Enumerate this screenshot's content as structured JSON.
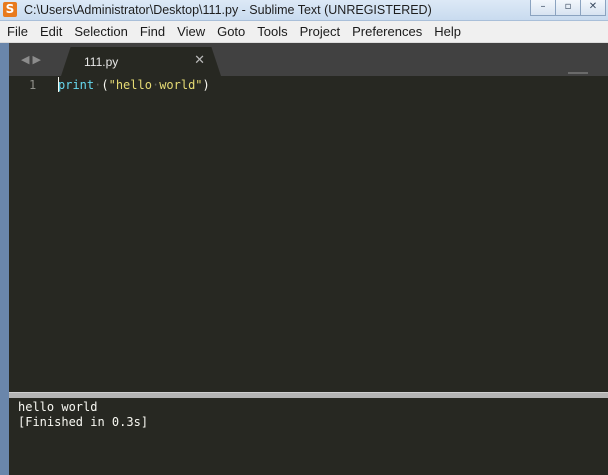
{
  "window": {
    "title": "C:\\Users\\Administrator\\Desktop\\111.py - Sublime Text (UNREGISTERED)",
    "icon": "sublime-text-icon"
  },
  "menu": [
    "File",
    "Edit",
    "Selection",
    "Find",
    "View",
    "Goto",
    "Tools",
    "Project",
    "Preferences",
    "Help"
  ],
  "tabs": [
    {
      "label": "111.py",
      "active": true
    }
  ],
  "editor": {
    "lines": [
      {
        "number": "1",
        "tokens": [
          "print",
          "·",
          "(\"hello",
          "·",
          "world\")"
        ]
      }
    ]
  },
  "output": {
    "lines": [
      "hello world",
      "[Finished in 0.3s]"
    ]
  },
  "colors": {
    "editor_bg": "#272822",
    "keyword": "#66d9ef",
    "string": "#e6db74",
    "tabbar_bg": "#414141"
  }
}
